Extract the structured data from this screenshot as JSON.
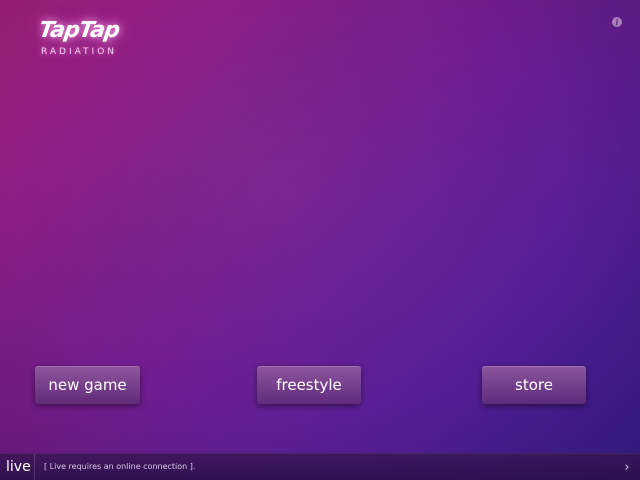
{
  "logo": {
    "title": "TapTap",
    "subtitle": "RADIATION"
  },
  "info_icon": {
    "icon": "info-icon",
    "glyph": "i"
  },
  "menu": {
    "new_game": "new game",
    "freestyle": "freestyle",
    "store": "store"
  },
  "live_bar": {
    "label": "live",
    "message": "[ Live requires an online connection ].",
    "chevron": "›"
  },
  "colors": {
    "background_top_left": "#a11f7a",
    "background_bottom_right": "#3a1e94",
    "button": "#7a3f96",
    "bar": "#2d1146"
  }
}
